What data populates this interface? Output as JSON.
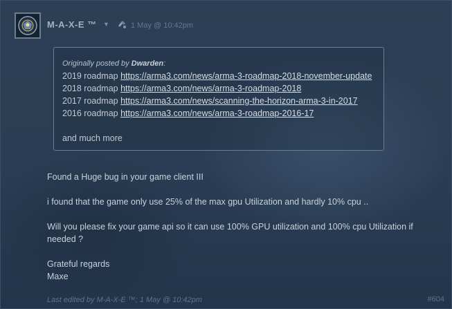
{
  "author": {
    "name": "M-A-X-E ™",
    "dropdown_icon": "chevron-down-icon",
    "award_icon": "award-icon",
    "timestamp": "1 May @ 10:42pm"
  },
  "quote": {
    "prefix": "Originally posted by ",
    "quoted_author": "Dwarden",
    "suffix": ":",
    "lines": [
      {
        "label": "2019 roadmap ",
        "url": "https://arma3.com/news/arma-3-roadmap-2018-november-update"
      },
      {
        "label": "2018 roadmap ",
        "url": "https://arma3.com/news/arma-3-roadmap-2018"
      },
      {
        "label": "2017 roadmap ",
        "url": "https://arma3.com/news/scanning-the-horizon-arma-3-in-2017"
      },
      {
        "label": "2016 roadmap ",
        "url": "https://arma3.com/news/arma-3-roadmap-2016-17"
      }
    ],
    "more": "and much more"
  },
  "body": {
    "p1": "Found a Huge bug in your game client III",
    "p2": "i found that the game only use 25% of the max gpu Utilization and hardly 10% cpu ..",
    "p3": "Will you please fix your game api so it can use 100% GPU utilization and 100% cpu Utilization if needed ?",
    "p4_line1": "Grateful regards",
    "p4_line2": "Maxe"
  },
  "footer": {
    "edited": "Last edited by M-A-X-E ™; 1 May @ 10:42pm",
    "post_number": "#604"
  },
  "colors": {
    "background": "#2a3d54",
    "link": "#d5dde5",
    "text": "#c9d2db",
    "muted": "#5f7387"
  }
}
